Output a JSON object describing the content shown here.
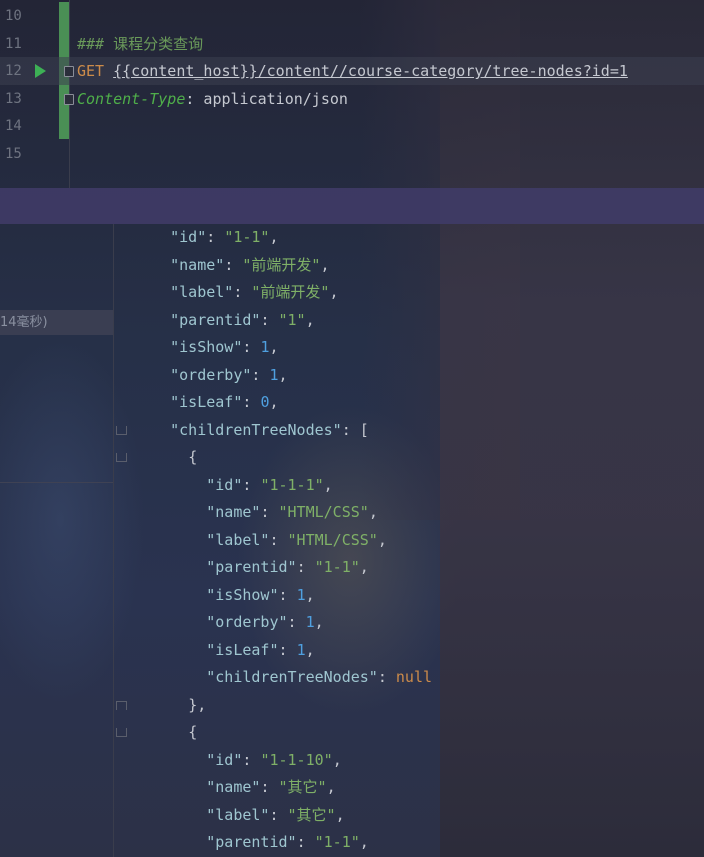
{
  "editor": {
    "lines": [
      {
        "num": "10",
        "parts": []
      },
      {
        "num": "11",
        "parts": [
          {
            "t": "### 课程分类查询",
            "c": "comment"
          }
        ]
      },
      {
        "num": "12",
        "current": true,
        "run": true,
        "fold": true,
        "parts": [
          {
            "t": "GET ",
            "c": "kw"
          },
          {
            "t": "{{content_host}}/content//course-category/tree-nodes?id=1",
            "c": "url"
          }
        ]
      },
      {
        "num": "13",
        "fold": true,
        "parts": [
          {
            "t": "Content-Type",
            "c": "ital"
          },
          {
            "t": ": application/json",
            "c": "p"
          }
        ]
      },
      {
        "num": "14",
        "parts": []
      },
      {
        "num": "15",
        "parts": []
      }
    ]
  },
  "left_panel": {
    "timing": "14毫秒)"
  },
  "response": {
    "lines": [
      {
        "indent": "    ",
        "parts": [
          {
            "t": "\"id\"",
            "c": "k"
          },
          {
            "t": ": ",
            "c": "p"
          },
          {
            "t": "\"1-1\"",
            "c": "s"
          },
          {
            "t": ",",
            "c": "p"
          }
        ]
      },
      {
        "indent": "    ",
        "parts": [
          {
            "t": "\"name\"",
            "c": "k"
          },
          {
            "t": ": ",
            "c": "p"
          },
          {
            "t": "\"前端开发\"",
            "c": "s"
          },
          {
            "t": ",",
            "c": "p"
          }
        ]
      },
      {
        "indent": "    ",
        "parts": [
          {
            "t": "\"label\"",
            "c": "k"
          },
          {
            "t": ": ",
            "c": "p"
          },
          {
            "t": "\"前端开发\"",
            "c": "s"
          },
          {
            "t": ",",
            "c": "p"
          }
        ]
      },
      {
        "indent": "    ",
        "parts": [
          {
            "t": "\"parentid\"",
            "c": "k"
          },
          {
            "t": ": ",
            "c": "p"
          },
          {
            "t": "\"1\"",
            "c": "s"
          },
          {
            "t": ",",
            "c": "p"
          }
        ]
      },
      {
        "indent": "    ",
        "parts": [
          {
            "t": "\"isShow\"",
            "c": "k"
          },
          {
            "t": ": ",
            "c": "p"
          },
          {
            "t": "1",
            "c": "n"
          },
          {
            "t": ",",
            "c": "p"
          }
        ]
      },
      {
        "indent": "    ",
        "parts": [
          {
            "t": "\"orderby\"",
            "c": "k"
          },
          {
            "t": ": ",
            "c": "p"
          },
          {
            "t": "1",
            "c": "n"
          },
          {
            "t": ",",
            "c": "p"
          }
        ]
      },
      {
        "indent": "    ",
        "parts": [
          {
            "t": "\"isLeaf\"",
            "c": "k"
          },
          {
            "t": ": ",
            "c": "p"
          },
          {
            "t": "0",
            "c": "n"
          },
          {
            "t": ",",
            "c": "p"
          }
        ]
      },
      {
        "indent": "    ",
        "fold": "down",
        "parts": [
          {
            "t": "\"childrenTreeNodes\"",
            "c": "k"
          },
          {
            "t": ": [",
            "c": "p"
          }
        ]
      },
      {
        "indent": "      ",
        "fold": "down",
        "parts": [
          {
            "t": "{",
            "c": "p"
          }
        ]
      },
      {
        "indent": "        ",
        "parts": [
          {
            "t": "\"id\"",
            "c": "k"
          },
          {
            "t": ": ",
            "c": "p"
          },
          {
            "t": "\"1-1-1\"",
            "c": "s"
          },
          {
            "t": ",",
            "c": "p"
          }
        ]
      },
      {
        "indent": "        ",
        "parts": [
          {
            "t": "\"name\"",
            "c": "k"
          },
          {
            "t": ": ",
            "c": "p"
          },
          {
            "t": "\"HTML/CSS\"",
            "c": "s"
          },
          {
            "t": ",",
            "c": "p"
          }
        ]
      },
      {
        "indent": "        ",
        "parts": [
          {
            "t": "\"label\"",
            "c": "k"
          },
          {
            "t": ": ",
            "c": "p"
          },
          {
            "t": "\"HTML/CSS\"",
            "c": "s"
          },
          {
            "t": ",",
            "c": "p"
          }
        ]
      },
      {
        "indent": "        ",
        "parts": [
          {
            "t": "\"parentid\"",
            "c": "k"
          },
          {
            "t": ": ",
            "c": "p"
          },
          {
            "t": "\"1-1\"",
            "c": "s"
          },
          {
            "t": ",",
            "c": "p"
          }
        ]
      },
      {
        "indent": "        ",
        "parts": [
          {
            "t": "\"isShow\"",
            "c": "k"
          },
          {
            "t": ": ",
            "c": "p"
          },
          {
            "t": "1",
            "c": "n"
          },
          {
            "t": ",",
            "c": "p"
          }
        ]
      },
      {
        "indent": "        ",
        "parts": [
          {
            "t": "\"orderby\"",
            "c": "k"
          },
          {
            "t": ": ",
            "c": "p"
          },
          {
            "t": "1",
            "c": "n"
          },
          {
            "t": ",",
            "c": "p"
          }
        ]
      },
      {
        "indent": "        ",
        "parts": [
          {
            "t": "\"isLeaf\"",
            "c": "k"
          },
          {
            "t": ": ",
            "c": "p"
          },
          {
            "t": "1",
            "c": "n"
          },
          {
            "t": ",",
            "c": "p"
          }
        ]
      },
      {
        "indent": "        ",
        "parts": [
          {
            "t": "\"childrenTreeNodes\"",
            "c": "k"
          },
          {
            "t": ": ",
            "c": "p"
          },
          {
            "t": "null",
            "c": "nul"
          }
        ]
      },
      {
        "indent": "      ",
        "fold": "up",
        "parts": [
          {
            "t": "},",
            "c": "p"
          }
        ]
      },
      {
        "indent": "      ",
        "fold": "down",
        "parts": [
          {
            "t": "{",
            "c": "p"
          }
        ]
      },
      {
        "indent": "        ",
        "parts": [
          {
            "t": "\"id\"",
            "c": "k"
          },
          {
            "t": ": ",
            "c": "p"
          },
          {
            "t": "\"1-1-10\"",
            "c": "s"
          },
          {
            "t": ",",
            "c": "p"
          }
        ]
      },
      {
        "indent": "        ",
        "parts": [
          {
            "t": "\"name\"",
            "c": "k"
          },
          {
            "t": ": ",
            "c": "p"
          },
          {
            "t": "\"其它\"",
            "c": "s"
          },
          {
            "t": ",",
            "c": "p"
          }
        ]
      },
      {
        "indent": "        ",
        "parts": [
          {
            "t": "\"label\"",
            "c": "k"
          },
          {
            "t": ": ",
            "c": "p"
          },
          {
            "t": "\"其它\"",
            "c": "s"
          },
          {
            "t": ",",
            "c": "p"
          }
        ]
      },
      {
        "indent": "        ",
        "parts": [
          {
            "t": "\"parentid\"",
            "c": "k"
          },
          {
            "t": ": ",
            "c": "p"
          },
          {
            "t": "\"1-1\"",
            "c": "s"
          },
          {
            "t": ",",
            "c": "p"
          }
        ]
      }
    ]
  }
}
